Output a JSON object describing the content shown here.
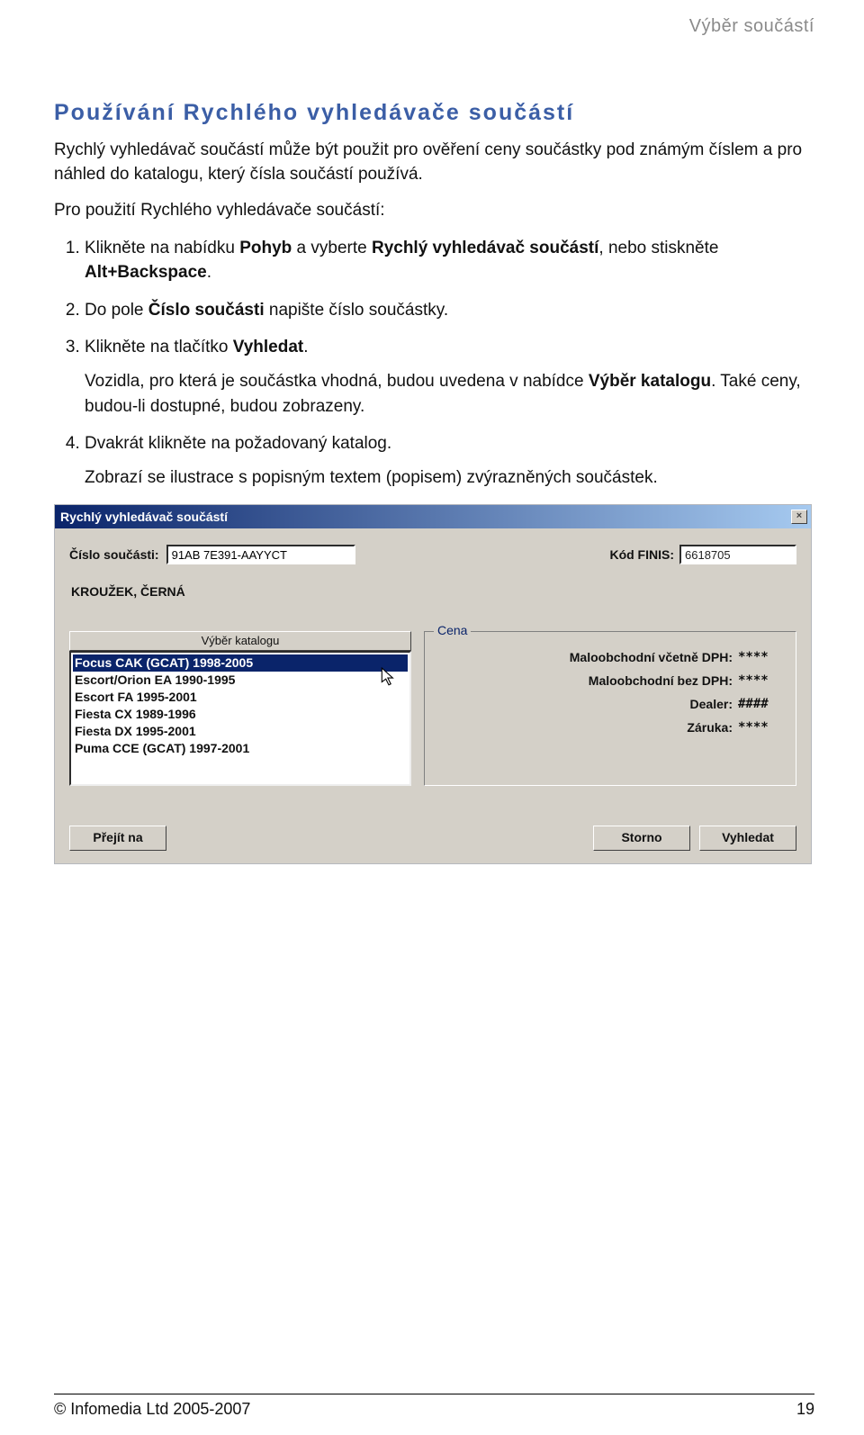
{
  "header": {
    "section": "Výběr součástí"
  },
  "title": "Používání Rychlého vyhledávače součástí",
  "intro": "Rychlý vyhledávač součástí může být použit pro ověření ceny součástky pod známým číslem a pro náhled do katalogu, který čísla součástí používá.",
  "intro2": "Pro použití Rychlého vyhledávače součástí:",
  "steps": {
    "s1_pre": "Klikněte na nabídku ",
    "s1_b1": "Pohyb",
    "s1_mid": " a vyberte ",
    "s1_b2": "Rychlý vyhledávač součástí",
    "s1_mid2": ", nebo stiskněte ",
    "s1_b3": "Alt+Backspace",
    "s1_end": ".",
    "s2_pre": "Do pole ",
    "s2_b1": "Číslo součásti",
    "s2_end": " napište číslo součástky.",
    "s3_pre": "Klikněte na tlačítko ",
    "s3_b1": "Vyhledat",
    "s3_end": ".",
    "s3_sub_pre": "Vozidla, pro která je součástka vhodná, budou uvedena v nabídce ",
    "s3_sub_b": "Výběr katalogu",
    "s3_sub_end": ". Také ceny, budou-li dostupné, budou zobrazeny.",
    "s4": "Dvakrát klikněte na požadovaný katalog.",
    "s4_sub": "Zobrazí se ilustrace s popisným textem (popisem) zvýrazněných součástek."
  },
  "dialog": {
    "title": "Rychlý vyhledávač součástí",
    "close": "×",
    "part_label": "Číslo součásti:",
    "part_value": "91AB 7E391-AAYYCT",
    "finis_label": "Kód FINIS:",
    "finis_value": "6618705",
    "description": "KROUŽEK, ČERNÁ",
    "list_header": "Výběr katalogu",
    "list": [
      "Focus CAK (GCAT) 1998-2005",
      "Escort/Orion EA 1990-1995",
      "Escort FA 1995-2001",
      "Fiesta CX 1989-1996",
      "Fiesta DX 1995-2001",
      "Puma CCE (GCAT) 1997-2001"
    ],
    "group_label": "Cena",
    "prices": [
      {
        "label": "Maloobchodní včetně DPH:",
        "val": "****"
      },
      {
        "label": "Maloobchodní bez DPH:",
        "val": "****"
      },
      {
        "label": "Dealer:",
        "val": "####"
      },
      {
        "label": "Záruka:",
        "val": "****"
      }
    ],
    "btn_go": "Přejít na",
    "btn_cancel": "Storno",
    "btn_search": "Vyhledat"
  },
  "footer": {
    "copyright": "© Infomedia Ltd 2005-2007",
    "page": "19"
  }
}
